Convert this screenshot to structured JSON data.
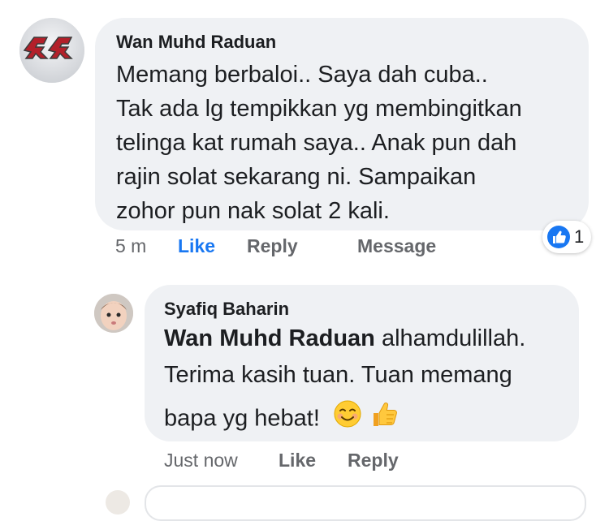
{
  "main_comment": {
    "author": "Wan Muhd Raduan",
    "avatar_icon": "rr-emblem-avatar",
    "lines": [
      "Memang berbaloi.. Saya dah cuba..",
      "Tak ada lg tempikkan yg membingitkan",
      "telinga kat rumah saya.. Anak pun dah",
      "rajin solat sekarang ni. Sampaikan",
      "zohor pun nak solat 2 kali."
    ],
    "time": "5 m",
    "like_label": "Like",
    "reply_label": "Reply",
    "message_label": "Message",
    "reaction_icon": "like-reaction-icon",
    "reaction_count": "1"
  },
  "reply_comment": {
    "author": "Syafiq Baharin",
    "avatar_icon": "baby-photo-avatar",
    "mention": "Wan Muhd Raduan",
    "line1_rest": " alhamdulillah.",
    "line2": "Terima kasih tuan. Tuan memang",
    "line3": "bapa yg hebat!",
    "emoji_icons": [
      "smiling-face-emoji",
      "thumbs-up-emoji"
    ],
    "time": "Just now",
    "like_label": "Like",
    "reply_label": "Reply"
  },
  "colors": {
    "bubble": "#eff1f4",
    "link_blue": "#1877f2",
    "secondary_text": "#65676b"
  }
}
